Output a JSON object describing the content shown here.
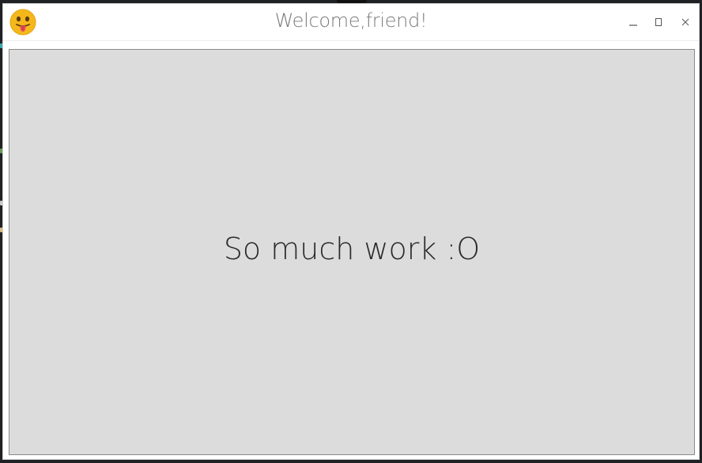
{
  "window": {
    "title": "Welcome,friend!"
  },
  "content": {
    "message": "So much work :O"
  },
  "icons": {
    "app": "tongue-out-emoji-icon",
    "minimize": "minimize-icon",
    "maximize": "maximize-icon",
    "close": "close-icon"
  },
  "colors": {
    "titlebar_bg": "#ffffff",
    "title_text": "#7a7a7a",
    "panel_bg": "#dcdcdc",
    "panel_border": "#8a8a8a",
    "message_text": "#2a2a2a",
    "emoji_face": "#f4b400"
  }
}
